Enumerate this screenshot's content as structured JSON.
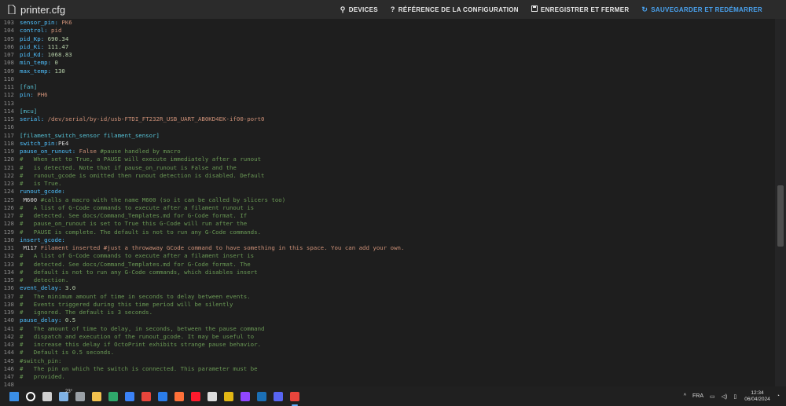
{
  "header": {
    "title": "printer.cfg",
    "buttons": [
      {
        "icon": "usb-icon",
        "label": "DEVICES"
      },
      {
        "icon": "help-icon",
        "label": "RÉFÉRENCE DE LA CONFIGURATION"
      },
      {
        "icon": "save-icon",
        "label": "ENREGISTRER ET FERMER"
      },
      {
        "icon": "restart-icon",
        "label": "SAUVEGARDER ET REDÉMARRER"
      }
    ]
  },
  "editor": {
    "lines": [
      {
        "n": "103",
        "tokens": [
          [
            "k",
            "sensor_pin: "
          ],
          [
            "v",
            "PK6"
          ]
        ]
      },
      {
        "n": "104",
        "tokens": [
          [
            "k",
            "control: "
          ],
          [
            "v",
            "pid"
          ]
        ]
      },
      {
        "n": "105",
        "tokens": [
          [
            "k",
            "pid_Kp: "
          ],
          [
            "n",
            "690.34"
          ]
        ]
      },
      {
        "n": "106",
        "tokens": [
          [
            "k",
            "pid_Ki: "
          ],
          [
            "n",
            "111.47"
          ]
        ]
      },
      {
        "n": "107",
        "tokens": [
          [
            "k",
            "pid_Kd: "
          ],
          [
            "n",
            "1068.83"
          ]
        ]
      },
      {
        "n": "108",
        "tokens": [
          [
            "k",
            "min_temp: "
          ],
          [
            "n",
            "0"
          ]
        ]
      },
      {
        "n": "109",
        "tokens": [
          [
            "k",
            "max_temp: "
          ],
          [
            "n",
            "130"
          ]
        ]
      },
      {
        "n": "110",
        "tokens": []
      },
      {
        "n": "111",
        "tokens": [
          [
            "s",
            "[fan]"
          ]
        ]
      },
      {
        "n": "112",
        "tokens": [
          [
            "k",
            "pin: "
          ],
          [
            "v",
            "PH6"
          ]
        ]
      },
      {
        "n": "113",
        "tokens": []
      },
      {
        "n": "114",
        "tokens": [
          [
            "s",
            "[mcu]"
          ]
        ]
      },
      {
        "n": "115",
        "tokens": [
          [
            "k",
            "serial: "
          ],
          [
            "v",
            "/dev/serial/by-id/usb-FTDI_FT232R_USB_UART_AB0KD4EK-if00-port0"
          ]
        ]
      },
      {
        "n": "116",
        "tokens": []
      },
      {
        "n": "117",
        "tokens": [
          [
            "s",
            "[filament_switch_sensor filament_sensor]"
          ]
        ]
      },
      {
        "n": "118",
        "tokens": [
          [
            "k",
            "switch_pin:"
          ],
          [
            "t",
            "PE4"
          ]
        ]
      },
      {
        "n": "119",
        "tokens": [
          [
            "k",
            "pause_on_runout: "
          ],
          [
            "v",
            "False "
          ],
          [
            "c",
            "#pause handled by macro"
          ]
        ]
      },
      {
        "n": "120",
        "tokens": [
          [
            "c",
            "#   When set to True, a PAUSE will execute immediately after a runout"
          ]
        ]
      },
      {
        "n": "121",
        "tokens": [
          [
            "c",
            "#   is detected. Note that if pause_on_runout is False and the"
          ]
        ]
      },
      {
        "n": "122",
        "tokens": [
          [
            "c",
            "#   runout_gcode is omitted then runout detection is disabled. Default"
          ]
        ]
      },
      {
        "n": "123",
        "tokens": [
          [
            "c",
            "#   is True."
          ]
        ]
      },
      {
        "n": "124",
        "tokens": [
          [
            "k",
            "runout_gcode:"
          ]
        ]
      },
      {
        "n": "125",
        "tokens": [
          [
            "t",
            " M600 "
          ],
          [
            "c",
            "#calls a macro with the name M600 (so it can be called by slicers too)"
          ]
        ]
      },
      {
        "n": "126",
        "tokens": [
          [
            "c",
            "#   A list of G-Code commands to execute after a filament runout is"
          ]
        ]
      },
      {
        "n": "127",
        "tokens": [
          [
            "c",
            "#   detected. See docs/Command_Templates.md for G-Code format. If"
          ]
        ]
      },
      {
        "n": "128",
        "tokens": [
          [
            "c",
            "#   pause_on_runout is set to True this G-Code will run after the"
          ]
        ]
      },
      {
        "n": "129",
        "tokens": [
          [
            "c",
            "#   PAUSE is complete. The default is not to run any G-Code commands."
          ]
        ]
      },
      {
        "n": "130",
        "tokens": [
          [
            "k",
            "insert_gcode:"
          ]
        ]
      },
      {
        "n": "131",
        "tokens": [
          [
            "t",
            " M117 "
          ],
          [
            "v",
            "Filament inserted #just a throwaway GCode command to have something in this space. You can add your own."
          ]
        ]
      },
      {
        "n": "132",
        "tokens": [
          [
            "c",
            "#   A list of G-Code commands to execute after a filament insert is"
          ]
        ]
      },
      {
        "n": "133",
        "tokens": [
          [
            "c",
            "#   detected. See docs/Command_Templates.md for G-Code format. The"
          ]
        ]
      },
      {
        "n": "134",
        "tokens": [
          [
            "c",
            "#   default is not to run any G-Code commands, which disables insert"
          ]
        ]
      },
      {
        "n": "135",
        "tokens": [
          [
            "c",
            "#   detection."
          ]
        ]
      },
      {
        "n": "136",
        "tokens": [
          [
            "k",
            "event_delay: "
          ],
          [
            "n",
            "3.0"
          ]
        ]
      },
      {
        "n": "137",
        "tokens": [
          [
            "c",
            "#   The minimum amount of time in seconds to delay between events."
          ]
        ]
      },
      {
        "n": "138",
        "tokens": [
          [
            "c",
            "#   Events triggered during this time period will be silently"
          ]
        ]
      },
      {
        "n": "139",
        "tokens": [
          [
            "c",
            "#   ignored. The default is 3 seconds."
          ]
        ]
      },
      {
        "n": "140",
        "tokens": [
          [
            "k",
            "pause_delay: "
          ],
          [
            "n",
            "0.5"
          ]
        ]
      },
      {
        "n": "141",
        "tokens": [
          [
            "c",
            "#   The amount of time to delay, in seconds, between the pause command"
          ]
        ]
      },
      {
        "n": "142",
        "tokens": [
          [
            "c",
            "#   dispatch and execution of the runout_gcode. It may be useful to"
          ]
        ]
      },
      {
        "n": "143",
        "tokens": [
          [
            "c",
            "#   increase this delay if OctoPrint exhibits strange pause behavior."
          ]
        ]
      },
      {
        "n": "144",
        "tokens": [
          [
            "c",
            "#   Default is 0.5 seconds."
          ]
        ]
      },
      {
        "n": "145",
        "tokens": [
          [
            "c",
            "#switch_pin:"
          ]
        ]
      },
      {
        "n": "146",
        "tokens": [
          [
            "c",
            "#   The pin on which the switch is connected. This parameter must be"
          ]
        ]
      },
      {
        "n": "147",
        "tokens": [
          [
            "c",
            "#   provided."
          ]
        ]
      },
      {
        "n": "148",
        "tokens": []
      }
    ]
  },
  "taskbar": {
    "weather": "23°",
    "icons": [
      {
        "name": "windows-start-icon",
        "color": "#3a8ee6"
      },
      {
        "name": "search-icon",
        "color": "#ffffff"
      },
      {
        "name": "task-view-icon",
        "color": "#cfcfcf"
      },
      {
        "name": "weather-widget-icon",
        "color": "#7fb2e5"
      },
      {
        "name": "camera-app-icon",
        "color": "#9aa0a6"
      },
      {
        "name": "file-explorer-icon",
        "color": "#f2c14e"
      },
      {
        "name": "edge-browser-icon",
        "color": "#2fa86b"
      },
      {
        "name": "store-icon",
        "color": "#3b82f6"
      },
      {
        "name": "chrome-icon",
        "color": "#e8453c"
      },
      {
        "name": "app-blue-icon",
        "color": "#2b7de9"
      },
      {
        "name": "firefox-icon",
        "color": "#ff7139"
      },
      {
        "name": "opera-icon",
        "color": "#ff1b2d"
      },
      {
        "name": "media-player-icon",
        "color": "#dddddd"
      },
      {
        "name": "photos-app-icon",
        "color": "#e2b714"
      },
      {
        "name": "twitch-icon",
        "color": "#9146ff"
      },
      {
        "name": "steam-icon",
        "color": "#1b6fb5"
      },
      {
        "name": "discord-icon",
        "color": "#5865f2"
      },
      {
        "name": "chrome-active-icon",
        "color": "#e8453c"
      }
    ],
    "lang": "FRA",
    "time": "12:34",
    "date": "06/04/2024"
  }
}
